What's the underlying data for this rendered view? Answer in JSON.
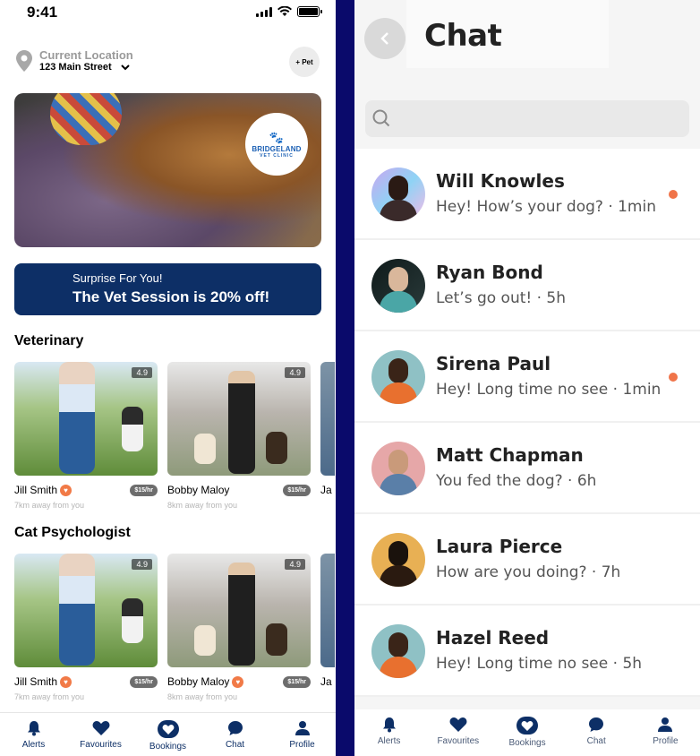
{
  "status": {
    "time": "9:41"
  },
  "location": {
    "label": "Current Location",
    "value": "123 Main Street"
  },
  "pet_button": "+ Pet",
  "hero": {
    "logo_line1": "BRIDGELAND",
    "logo_line2": "VET CLINIC"
  },
  "promo": {
    "line1": "Surprise For You!",
    "line2": "The Vet Session is 20% off!"
  },
  "sections": [
    {
      "title": "Veterinary",
      "cards": [
        {
          "name": "Jill Smith",
          "rating": "4.9",
          "price": "$15/hr",
          "distance": "7km away from you"
        },
        {
          "name": "Bobby Maloy",
          "rating": "4.9",
          "price": "$15/hr",
          "distance": "8km away from you"
        },
        {
          "name": "Ja"
        }
      ]
    },
    {
      "title": "Cat Psychologist",
      "cards": [
        {
          "name": "Jill Smith",
          "rating": "4.9",
          "price": "$15/hr",
          "distance": "7km away from you"
        },
        {
          "name": "Bobby Maloy",
          "rating": "4.9",
          "price": "$15/hr",
          "distance": "8km away from you"
        },
        {
          "name": "Ja"
        }
      ]
    }
  ],
  "tabs": [
    "Alerts",
    "Favourites",
    "Bookings",
    "Chat",
    "Profile"
  ],
  "chat": {
    "title": "Chat",
    "search_placeholder": "",
    "items": [
      {
        "name": "Will Knowles",
        "message": "Hey! How’s your dog? · 1min",
        "unread": true
      },
      {
        "name": "Ryan Bond",
        "message": "Let’s go out! · 5h",
        "unread": false
      },
      {
        "name": "Sirena Paul",
        "message": "Hey! Long time no see · 1min",
        "unread": true
      },
      {
        "name": "Matt Chapman",
        "message": "You fed the dog? · 6h",
        "unread": false
      },
      {
        "name": "Laura Pierce",
        "message": "How are you doing? · 7h",
        "unread": false
      },
      {
        "name": "Hazel Reed",
        "message": "Hey! Long time no see · 5h",
        "unread": false
      }
    ]
  },
  "colors": {
    "navy": "#0d2f66",
    "accent": "#f07449",
    "divider": "#0a0a6b"
  }
}
